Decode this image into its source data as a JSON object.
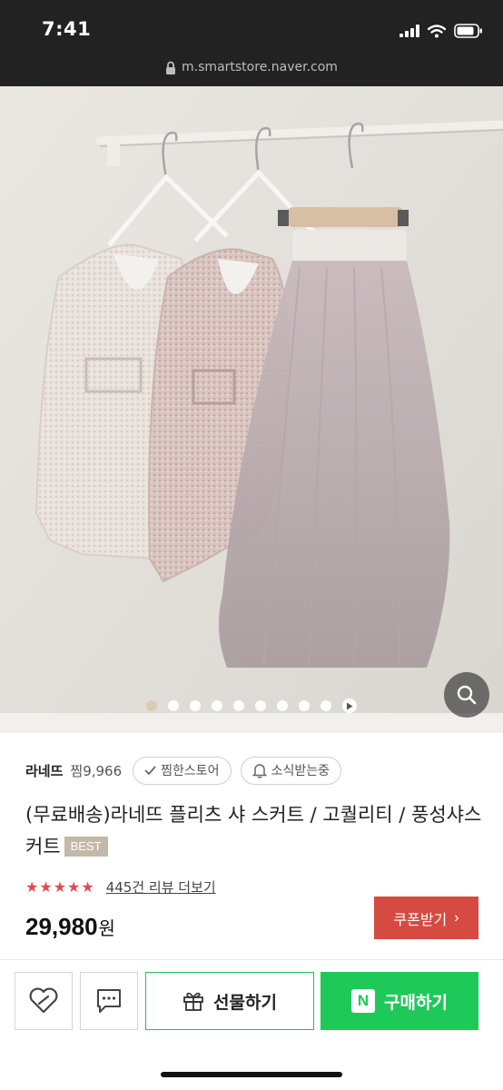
{
  "status_bar": {
    "time": "7:41"
  },
  "browser": {
    "url": "m.smartstore.naver.com"
  },
  "product_image": {
    "alt": "",
    "dot_count": 9,
    "active_dot": 0
  },
  "store": {
    "name": "라네뜨",
    "zzim_count": "찜9,966",
    "zzim_store_label": "찜한스토어",
    "notify_label": "소식받는중"
  },
  "product": {
    "title": "(무료배송)라네뜨 플리츠 샤 스커트 / 고퀄리티 / 풍성샤스커트",
    "badge": "BEST",
    "stars": "★★★★★",
    "review_link": "445건 리뷰 더보기",
    "price": "29,980",
    "price_unit": "원"
  },
  "coupon": {
    "label": "쿠폰받기",
    "arrow": "›"
  },
  "actions": {
    "gift_label": "선물하기",
    "buy_label": "구매하기",
    "npay_mark": "N"
  },
  "colors": {
    "accent_green": "#1ec95a",
    "coupon_red": "#d54b42",
    "star_red": "#e5484d",
    "badge_beige": "#c3b9a8"
  }
}
